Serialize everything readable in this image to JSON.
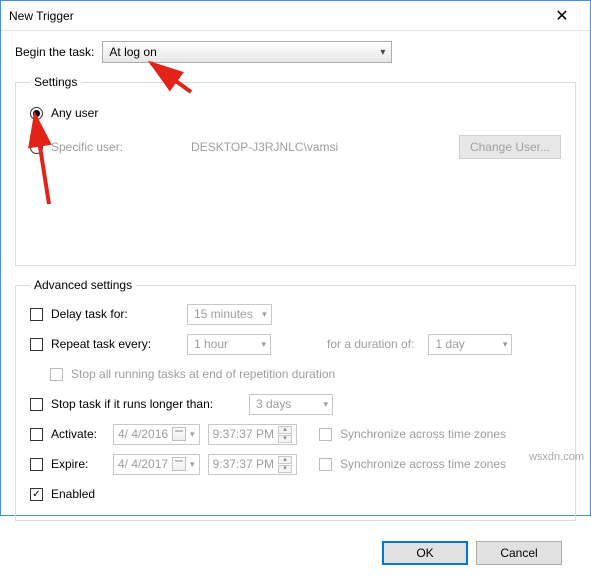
{
  "window": {
    "title": "New Trigger"
  },
  "begin": {
    "label": "Begin the task:",
    "value": "At log on"
  },
  "settings": {
    "legend": "Settings",
    "any_user_label": "Any user",
    "specific_user_label": "Specific user:",
    "specific_user_value": "DESKTOP-J3RJNLC\\vamsi",
    "change_user_label": "Change User..."
  },
  "advanced": {
    "legend": "Advanced settings",
    "delay_label": "Delay task for:",
    "delay_value": "15 minutes",
    "repeat_label": "Repeat task every:",
    "repeat_value": "1 hour",
    "duration_label": "for a duration of:",
    "duration_value": "1 day",
    "stop_repetition_label": "Stop all running tasks at end of repetition duration",
    "stop_if_longer_label": "Stop task if it runs longer than:",
    "stop_if_longer_value": "3 days",
    "activate_label": "Activate:",
    "activate_date": "4/ 4/2016",
    "activate_time": "9:37:37 PM",
    "sync_label": "Synchronize across time zones",
    "expire_label": "Expire:",
    "expire_date": "4/ 4/2017",
    "expire_time": "9:37:37 PM",
    "enabled_label": "Enabled"
  },
  "buttons": {
    "ok": "OK",
    "cancel": "Cancel"
  },
  "watermark": "wsxdn.com"
}
